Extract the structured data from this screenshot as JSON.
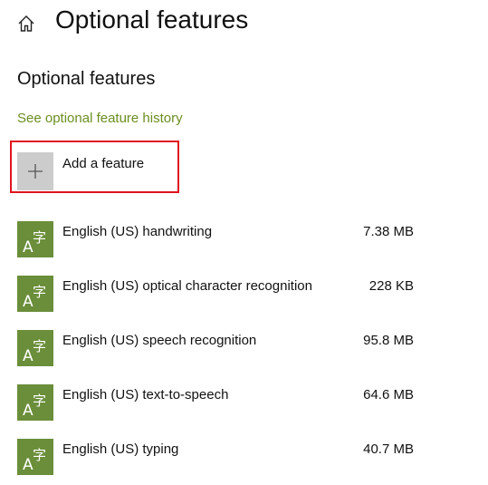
{
  "header": {
    "home_icon": "home-icon",
    "title": "Optional features"
  },
  "section": {
    "heading": "Optional features",
    "history_link": "See optional feature history"
  },
  "add_feature": {
    "icon": "plus-icon",
    "label": "Add a feature"
  },
  "features": [
    {
      "name": "English (US) handwriting",
      "size": "7.38 MB",
      "icon": "language-icon"
    },
    {
      "name": "English (US) optical character recognition",
      "size": "228 KB",
      "icon": "language-icon"
    },
    {
      "name": "English (US) speech recognition",
      "size": "95.8 MB",
      "icon": "language-icon"
    },
    {
      "name": "English (US) text-to-speech",
      "size": "64.6 MB",
      "icon": "language-icon"
    },
    {
      "name": "English (US) typing",
      "size": "40.7 MB",
      "icon": "language-icon"
    }
  ],
  "colors": {
    "accent": "#6b8e23",
    "tile": "#6a8e3a",
    "highlight_border": "#e0141e",
    "add_tile": "#cccccc"
  }
}
